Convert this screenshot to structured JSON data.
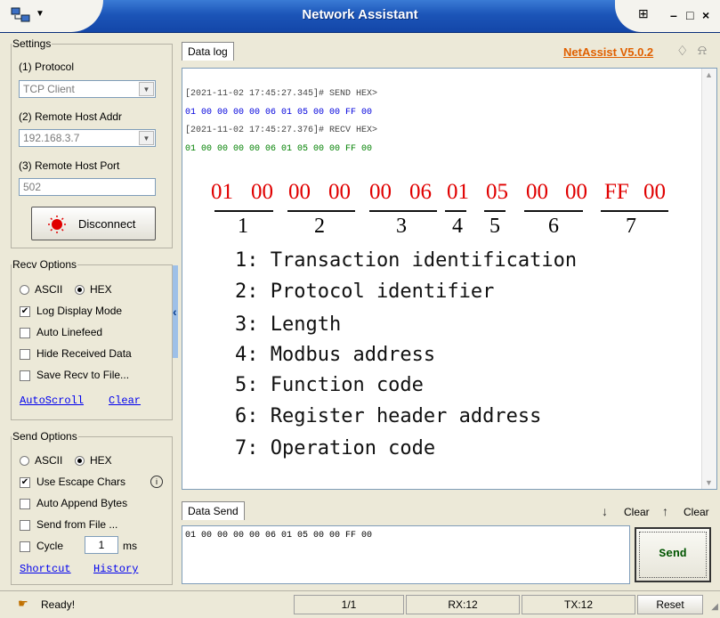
{
  "window": {
    "title": "Network Assistant"
  },
  "settings": {
    "legend": "Settings",
    "protocol_label": "(1) Protocol",
    "protocol_value": "TCP Client",
    "host_label": "(2) Remote Host Addr",
    "host_value": "192.168.3.7",
    "port_label": "(3) Remote Host Port",
    "port_value": "502",
    "disconnect_label": "Disconnect"
  },
  "recv": {
    "legend": "Recv Options",
    "ascii": "ASCII",
    "hex": "HEX",
    "options": [
      {
        "label": "Log Display Mode",
        "checked": true
      },
      {
        "label": "Auto Linefeed",
        "checked": false
      },
      {
        "label": "Hide Received Data",
        "checked": false
      },
      {
        "label": "Save Recv to File...",
        "checked": false
      }
    ],
    "autoscroll": "AutoScroll",
    "clear": "Clear"
  },
  "send": {
    "legend": "Send Options",
    "ascii": "ASCII",
    "hex": "HEX",
    "escape_label": "Use Escape Chars",
    "append_label": "Auto Append Bytes",
    "file_label": "Send from File ...",
    "cycle_label": "Cycle",
    "cycle_value": "1",
    "cycle_unit": "ms",
    "shortcut": "Shortcut",
    "history": "History"
  },
  "log": {
    "tab": "Data log",
    "brand": "NetAssist V5.0.2",
    "lines": [
      "[2021-11-02 17:45:27.345]# SEND HEX>",
      "01 00 00 00 00 06 01 05 00 00 FF 00",
      "[2021-11-02 17:45:27.376]# RECV HEX>",
      "01 00 00 00 00 06 01 05 00 00 FF 00"
    ],
    "bytes": [
      "01",
      "00",
      "00",
      "00",
      "00",
      "06",
      "01",
      "05",
      "00",
      "00",
      "FF",
      "00"
    ],
    "group_numbers": [
      "1",
      "2",
      "3",
      "4",
      "5",
      "6",
      "7"
    ],
    "legend_items": [
      "1: Transaction identification",
      "2: Protocol identifier",
      "3: Length",
      "4: Modbus address",
      "5: Function code",
      "6: Register header address",
      "7: Operation code"
    ]
  },
  "datasend": {
    "tab": "Data Send",
    "clear1": "Clear",
    "clear2": "Clear",
    "content": "01 00 00 00 00 06 01 05 00 00 FF 00",
    "send_button": "Send"
  },
  "status": {
    "ready": "Ready!",
    "page": "1/1",
    "rx": "RX:12",
    "tx": "TX:12",
    "reset": "Reset"
  },
  "colors": {
    "send_hex": "#0000dd",
    "recv_hex": "#008000",
    "brand": "#e06000",
    "annotation": "#e00000"
  }
}
